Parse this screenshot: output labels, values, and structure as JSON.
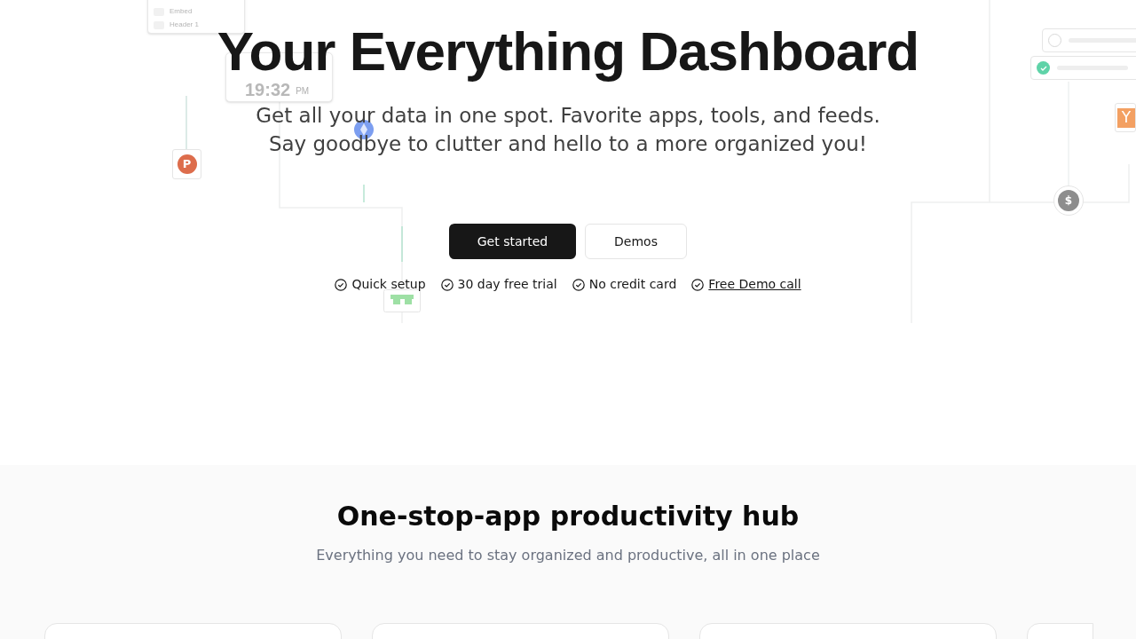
{
  "background_art": {
    "embed_menu": [
      "Embed",
      "Header 1"
    ],
    "clock": {
      "time": "19:32",
      "period": "PM"
    },
    "badge_p": "P",
    "badge_y": "Y",
    "badge_dollar": "$",
    "todo_items": [
      {
        "checked": false
      },
      {
        "checked": true
      }
    ]
  },
  "hero": {
    "title": "Your Everything Dashboard",
    "subtitle": [
      "Get all your data in one spot. Favorite apps, tools, and feeds.",
      "Say goodbye to clutter and hello to a more organized you!"
    ],
    "buttons": [
      {
        "label": "Get started",
        "kind": "primary"
      },
      {
        "label": "Demos",
        "kind": "secondary"
      }
    ],
    "features": [
      {
        "label": "Quick setup",
        "kind": "text"
      },
      {
        "label": "30 day free trial",
        "kind": "text"
      },
      {
        "label": "No credit card",
        "kind": "text"
      },
      {
        "label": "Free Demo call",
        "kind": "link"
      }
    ]
  },
  "hub": {
    "title": "One-stop-app productivity hub",
    "subtitle": "Everything you need to stay organized and productive, all in one place"
  }
}
